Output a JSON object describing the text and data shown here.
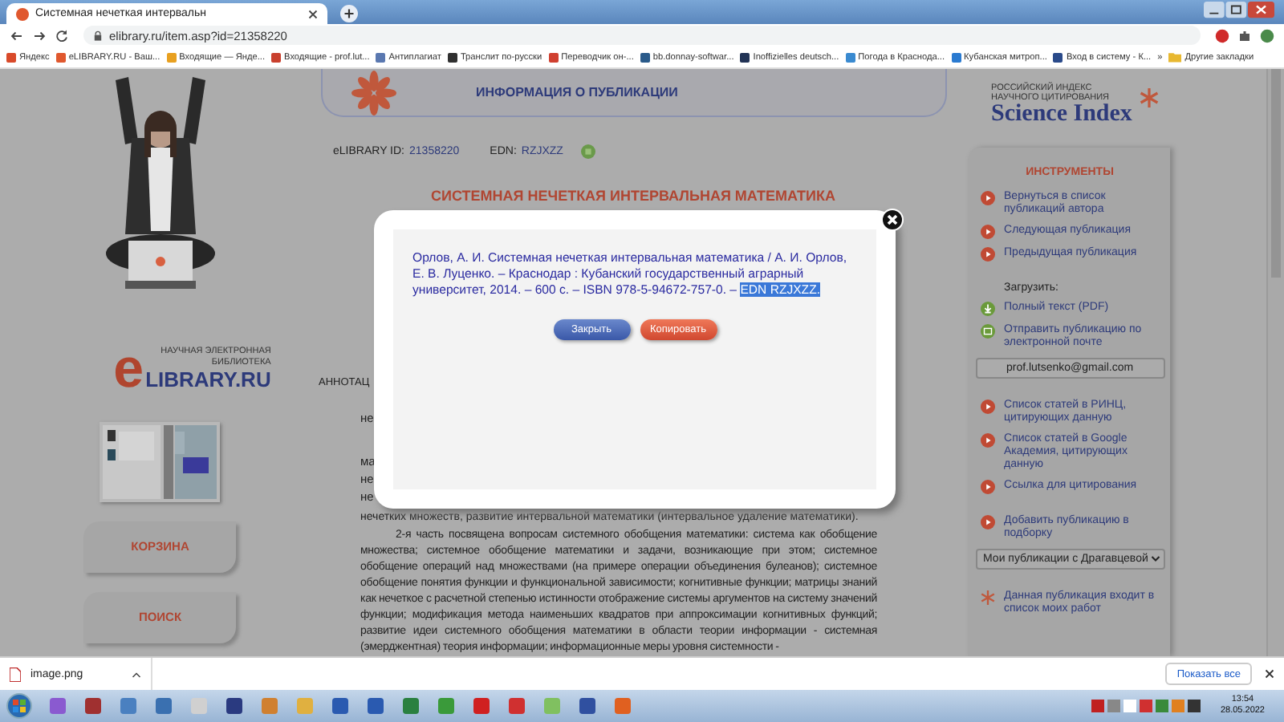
{
  "browser": {
    "tabs": [
      {
        "title": "Системная нечеткая интервальн",
        "selected": true
      }
    ],
    "address": "elibrary.ru/item.asp?id=21358220",
    "bookmarks": [
      {
        "label": "Яндекс",
        "color": "#d94a2a"
      },
      {
        "label": "eLIBRARY.RU - Ваш...",
        "color": "#e0582e"
      },
      {
        "label": "Входящие — Янде...",
        "color": "#e8a020"
      },
      {
        "label": "Входящие - prof.lut...",
        "color": "#c9402e"
      },
      {
        "label": "Антиплагиат",
        "color": "#5a78b0"
      },
      {
        "label": "Транслит по-русски",
        "color": "#303030"
      },
      {
        "label": "Переводчик он-...",
        "color": "#d04030"
      },
      {
        "label": "bb.donnay-softwar...",
        "color": "#2a5a8a"
      },
      {
        "label": "Inoffizielles deutsch...",
        "color": "#223355"
      },
      {
        "label": "Погода в Краснода...",
        "color": "#3a8ad0"
      },
      {
        "label": "Кубанская митроп...",
        "color": "#2a7ad0"
      },
      {
        "label": "Вход в систему - К...",
        "color": "#2a4a8a"
      }
    ],
    "more": "»",
    "other_bookmarks": "Другие закладки"
  },
  "left": {
    "logo": {
      "tagline_1": "НАУЧНАЯ ЭЛЕКТРОННАЯ",
      "tagline_2": "БИБЛИОТЕКА",
      "mark": "e",
      "name": "LIBRARY.RU"
    },
    "buttons": [
      "КОРЗИНА",
      "ПОИСК"
    ]
  },
  "publication": {
    "header": "ИНФОРМАЦИЯ О ПУБЛИКАЦИИ",
    "id_label": "eLIBRARY ID:",
    "id": "21358220",
    "edn_label": "EDN:",
    "edn": "RZJXZZ",
    "title": "СИСТЕМНАЯ НЕЧЕТКАЯ ИНТЕРВАЛЬНАЯ МАТЕМАТИКА",
    "annotation_label": "АННОТАЦ",
    "annotation_fragments": [
      "не",
      "ма",
      "не",
      "не"
    ],
    "annotation_last_line": "нечетких множеств, развитие интервальной математики (интервальное удаление математики).",
    "paragraph": "2-я часть посвящена вопросам системного обобщения математики: система как обобщение множества; системное обобщение математики и задачи, возникающие при этом; системное обобщение операций над множествами (на примере операции объединения булеанов); системное обобщение понятия функции и функциональной зависимости; когнитивные функции; матрицы знаний как нечеткое с расчетной степенью истинности отображение системы аргументов на систему значений функции; модификация метода наименьших квадратов при аппроксимации когнитивных функций; развитие идеи системного обобщения математики в области теории информации - системная (эмерджентная) теория информации; информационные меры уровня системности -"
  },
  "tools": {
    "logo_1": "РОССИЙСКИЙ ИНДЕКС",
    "logo_2": "НАУЧНОГО ЦИТИРОВАНИЯ",
    "logo_name": "Science Index",
    "title": "ИНСТРУМЕНТЫ",
    "groups": [
      [
        {
          "kind": "link",
          "text": "Вернуться в список публикаций автора"
        },
        {
          "kind": "link",
          "text": "Следующая публикация"
        },
        {
          "kind": "link",
          "text": "Предыдущая публикация"
        }
      ],
      [
        {
          "kind": "label",
          "text": "Загрузить:"
        },
        {
          "kind": "download",
          "text": "Полный текст (PDF)"
        },
        {
          "kind": "mail",
          "text": "Отправить публикацию по электронной почте"
        },
        {
          "kind": "field",
          "text": "prof.lutsenko@gmail.com"
        }
      ],
      [
        {
          "kind": "link",
          "text": "Список статей в РИНЦ, цитирующих данную"
        },
        {
          "kind": "link",
          "text": "Список статей в Google Академия, цитирующих данную"
        },
        {
          "kind": "link",
          "text": "Ссылка для цитирования"
        }
      ],
      [
        {
          "kind": "link",
          "text": "Добавить публикацию в подборку"
        },
        {
          "kind": "select",
          "text": "Мои публикации с Драгавцевой"
        }
      ],
      [
        {
          "kind": "star",
          "text": "Данная публикация входит в список моих работ"
        }
      ]
    ]
  },
  "dialog": {
    "citation": "Орлов, А. И. Системная нечеткая интервальная математика / А. И. Орлов, Е. В. Луценко. – Краснодар : Кубанский государственный аграрный университет, 2014. – 600 с. – ISBN 978-5-94672-757-0. – ",
    "selected_text": "EDN RZJXZZ.",
    "buttons": [
      {
        "label": "Закрыть",
        "kind": "close"
      },
      {
        "label": "Копировать",
        "kind": "copy"
      }
    ]
  },
  "downloads": {
    "file": "image.png",
    "show_all": "Показать все"
  },
  "taskbar": {
    "time": "13:54",
    "date": "28.05.2022"
  }
}
